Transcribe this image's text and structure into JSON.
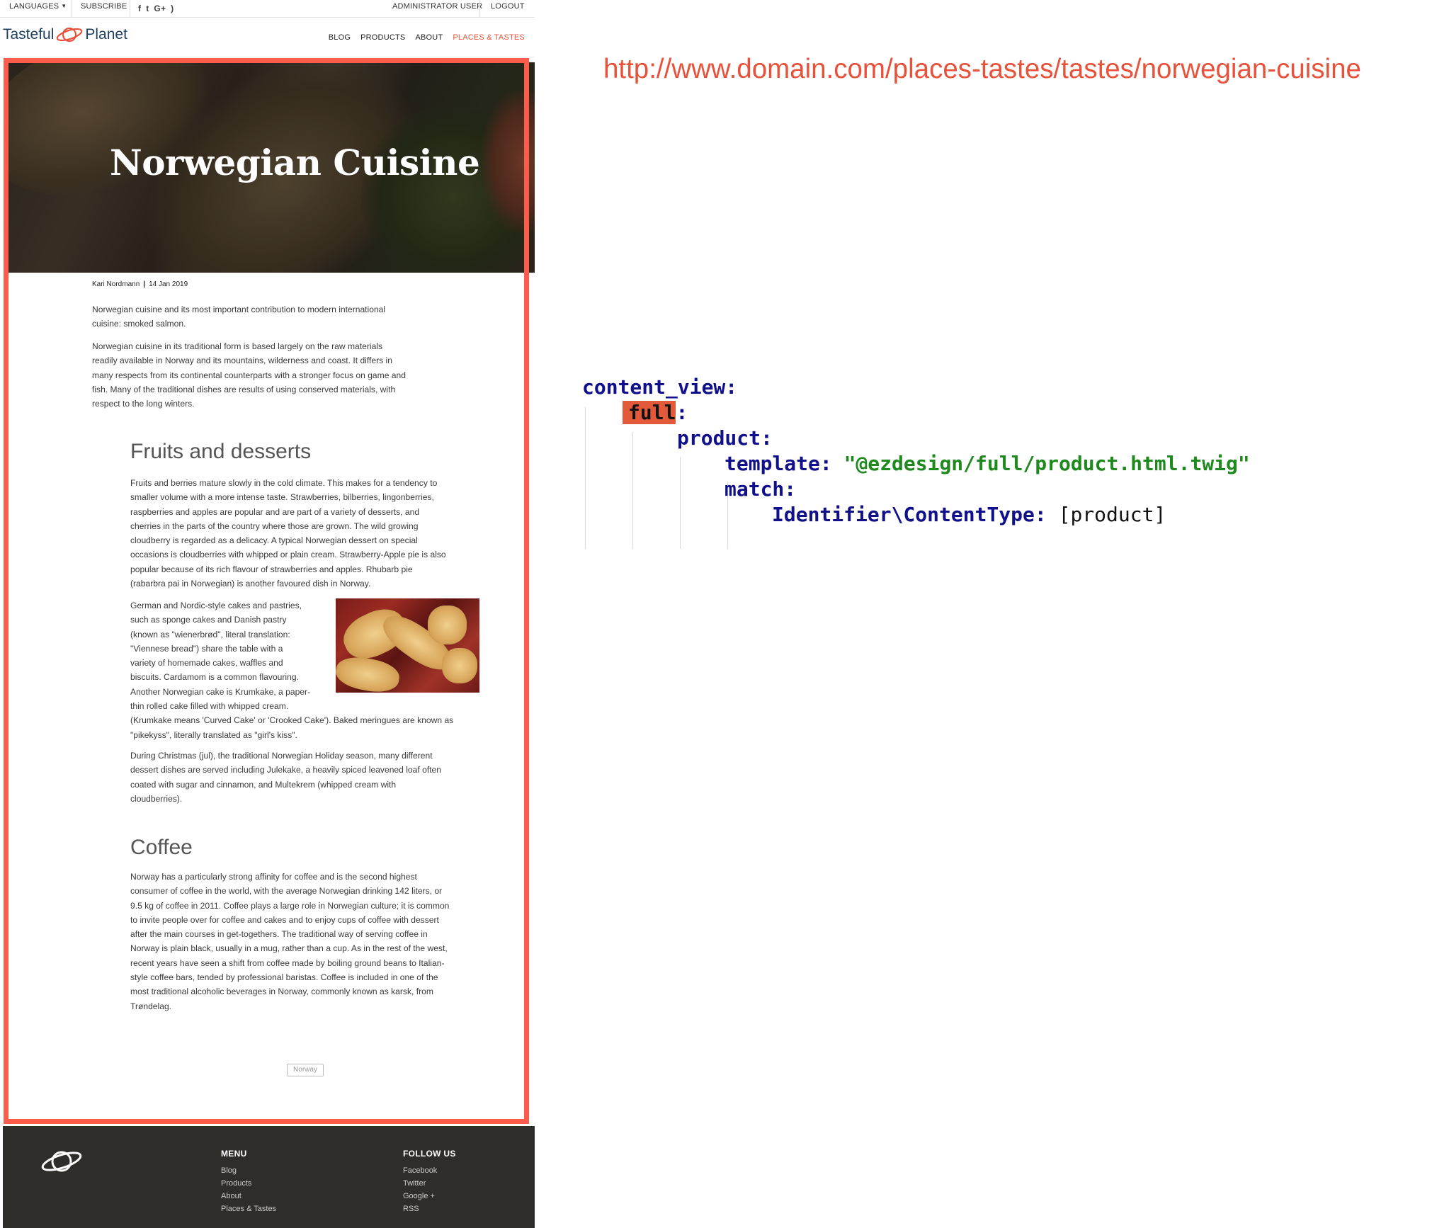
{
  "topbar": {
    "languages": "LANGUAGES",
    "subscribe": "SUBSCRIBE",
    "social_icons": [
      "facebook-icon",
      "twitter-icon",
      "google-plus-icon",
      "rss-icon"
    ],
    "social_glyphs": [
      "f",
      "t",
      "G+",
      ")"
    ],
    "user": "ADMINISTRATOR USER",
    "logout": "LOGOUT"
  },
  "logo": {
    "left": "Tasteful",
    "right": "Planet"
  },
  "nav": {
    "items": [
      "BLOG",
      "PRODUCTS",
      "ABOUT",
      "PLACES & TASTES"
    ],
    "active": "PLACES & TASTES"
  },
  "article": {
    "title": "Norwegian Cuisine",
    "author": "Kari Nordmann",
    "separator": "|",
    "date": "14 Jan 2019",
    "intro_lines": [
      "Norwegian cuisine and its most important contribution to modern international",
      "cuisine: smoked salmon."
    ],
    "para1_lines": [
      "Norwegian cuisine in its traditional form is based largely on the raw materials",
      "readily available in Norway and its mountains, wilderness and coast. It differs in",
      "many respects from its continental counterparts with a stronger focus on game and",
      "fish. Many of the traditional dishes are results of using conserved materials, with",
      "respect to the long winters."
    ],
    "heading_fruits": "Fruits and desserts",
    "fruits_lines": [
      "Fruits and berries mature slowly in the cold climate. This makes for a tendency to",
      "smaller volume with a more intense taste. Strawberries, bilberries, lingonberries,",
      "raspberries and apples are popular and are part of a variety of desserts, and",
      "cherries in the parts of the country where those are grown. The wild growing",
      "cloudberry is regarded as a delicacy. A typical Norwegian dessert on special",
      "occasions is cloudberries with whipped or plain cream. Strawberry-Apple pie is also",
      "popular because of its rich flavour of strawberries and apples. Rhubarb pie",
      "(rabarbra pai in Norwegian) is another favoured dish in Norway."
    ],
    "cakes_lines": [
      "German and Nordic-style cakes and pastries,",
      "such as sponge cakes and Danish pastry",
      "(known as \"wienerbrød\", literal translation:",
      "\"Viennese bread\") share the table with a",
      "variety of homemade cakes, waffles and",
      "biscuits. Cardamom is a common flavouring.",
      "Another Norwegian cake is Krumkake, a paper-",
      "thin rolled cake filled with whipped cream.",
      "(Krumkake means 'Curved Cake' or 'Crooked Cake'). Baked meringues are known as",
      "\"pikekyss\", literally translated as \"girl's kiss\"."
    ],
    "christmas_lines": [
      "During Christmas (jul), the traditional Norwegian Holiday season, many different",
      "dessert dishes are served including Julekake, a heavily spiced leavened loaf often",
      "coated with sugar and cinnamon, and Multekrem (whipped cream with",
      "cloudberries)."
    ],
    "heading_coffee": "Coffee",
    "coffee_lines": [
      "Norway has a particularly strong affinity for coffee and is the second highest",
      "consumer of coffee in the world, with the average Norwegian drinking 142 liters, or",
      "9.5 kg of coffee in 2011. Coffee plays a large role in Norwegian culture; it is common",
      "to invite people over for coffee and cakes and to enjoy cups of coffee with dessert",
      "after the main courses in get-togethers. The traditional way of serving coffee in",
      "Norway is plain black, usually in a mug, rather than a cup. As in the rest of the west,",
      "recent years have seen a shift from coffee made by boiling ground beans to Italian-",
      "style coffee bars, tended by professional baristas. Coffee is included in one of the",
      "most traditional alcoholic beverages in Norway, commonly known as karsk, from",
      "Trøndelag."
    ],
    "tag": "Norway"
  },
  "footer": {
    "menu_title": "MENU",
    "menu_items": [
      "Blog",
      "Products",
      "About",
      "Places & Tastes"
    ],
    "follow_title": "FOLLOW US",
    "follow_items": [
      "Facebook",
      "Twitter",
      "Google +",
      "RSS"
    ]
  },
  "annotation": {
    "url": "http://www.domain.com/places-tastes/tastes/norwegian-cuisine",
    "code": {
      "l1": "content_view:",
      "l2": "full",
      "l2_colon": ":",
      "l3": "product:",
      "l4_key": "template:",
      "l4_val": "\"@ezdesign/full/product.html.twig\"",
      "l5": "match:",
      "l6_key": "Identifier\\ContentType:",
      "l6_val": "[product]"
    }
  },
  "colors": {
    "accent": "#e8523b",
    "frame": "#fb5c4b",
    "footer_bg": "#2f2d2a",
    "brand": "#1f3f63",
    "code_key": "#10108a",
    "code_string": "#1e8a1e"
  }
}
